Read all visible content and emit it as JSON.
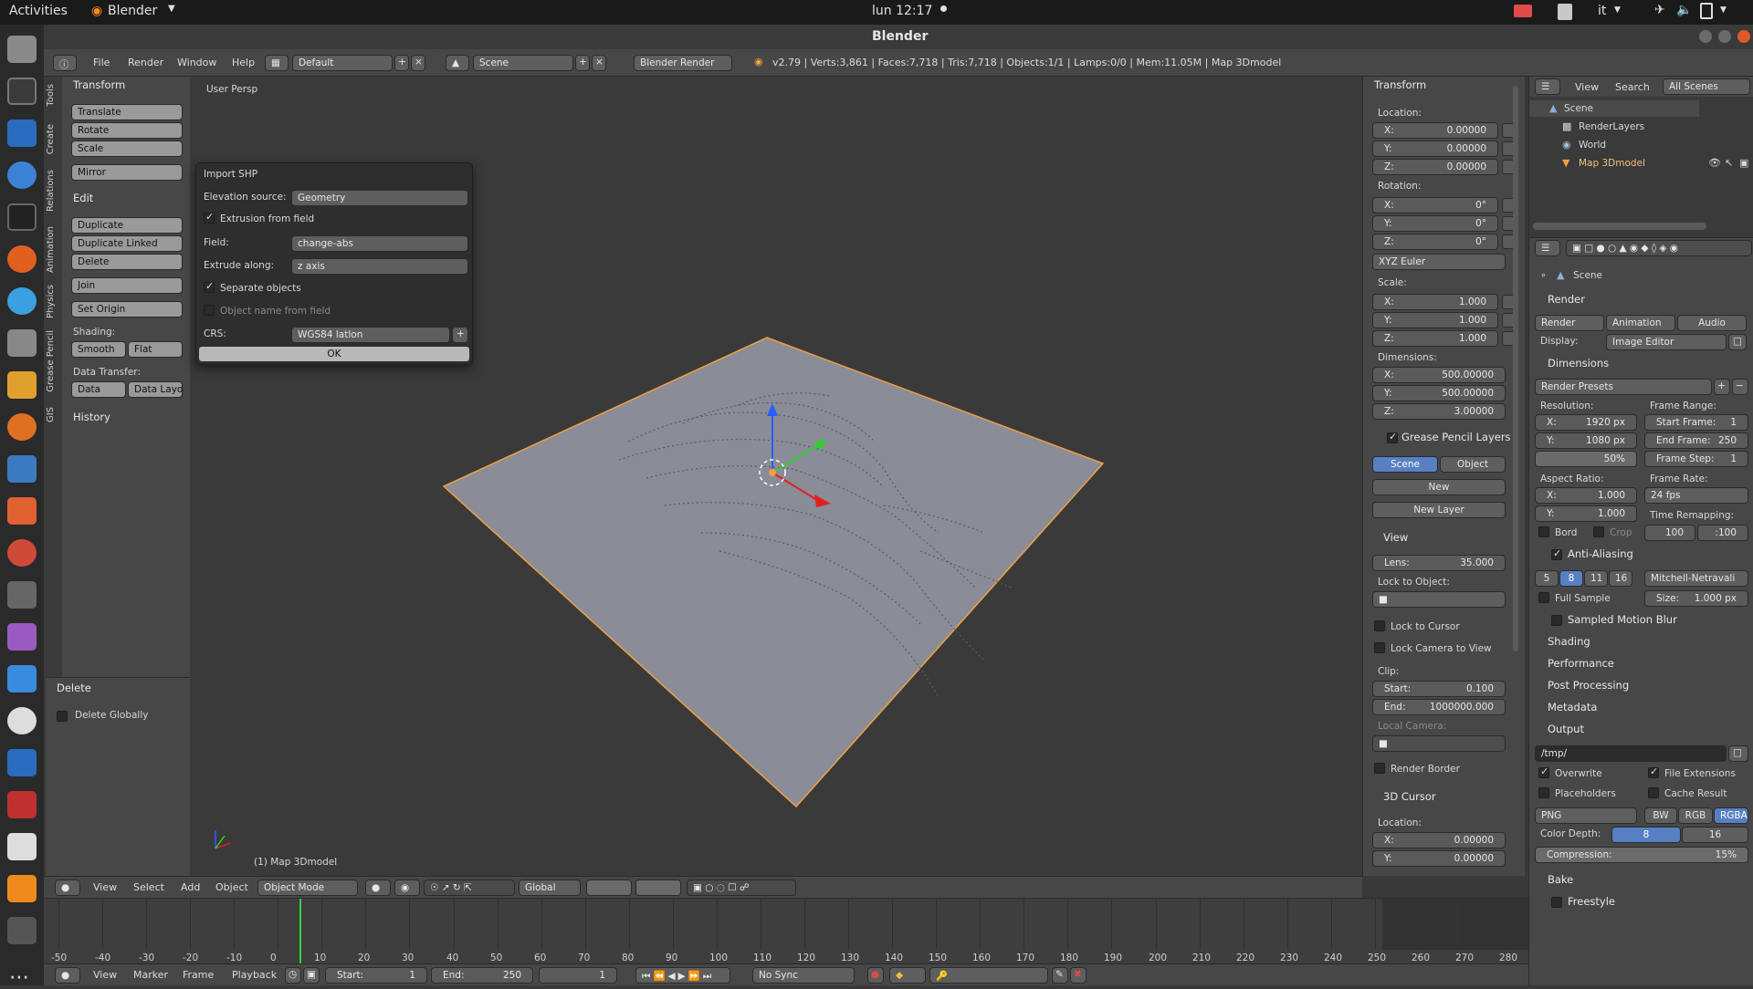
{
  "topbar": {
    "activities": "Activities",
    "app_menu": "Blender",
    "clock": "lun 12:17",
    "lang": "it"
  },
  "window": {
    "title": "Blender"
  },
  "infobar": {
    "menus": [
      "File",
      "Render",
      "Window",
      "Help"
    ],
    "layout": "Default",
    "scene": "Scene",
    "engine": "Blender Render",
    "stats": "v2.79 | Verts:3,861 | Faces:7,718 | Tris:7,718 | Objects:1/1 | Lamps:0/0 | Mem:11.05M | Map 3Dmodel"
  },
  "toolshelf": {
    "vtabs": [
      "Tools",
      "Create",
      "Relations",
      "Animation",
      "Physics",
      "Grease Pencil",
      "GIS"
    ],
    "transform_header": "Transform",
    "translate": "Translate",
    "rotate": "Rotate",
    "scale": "Scale",
    "mirror": "Mirror",
    "edit_header": "Edit",
    "duplicate": "Duplicate",
    "duplicate_linked": "Duplicate Linked",
    "delete": "Delete",
    "join": "Join",
    "set_origin": "Set Origin",
    "shading_label": "Shading:",
    "smooth": "Smooth",
    "flat": "Flat",
    "data_transfer_label": "Data Transfer:",
    "data": "Data",
    "data_layo": "Data Layo",
    "history_header": "History",
    "delete_header": "Delete",
    "delete_globally": "Delete Globally"
  },
  "dialog": {
    "title": "Import SHP",
    "elevation_label": "Elevation source:",
    "elevation_value": "Geometry",
    "extrusion_label": "Extrusion from field",
    "field_label": "Field:",
    "field_value": "change-abs",
    "extrude_label": "Extrude along:",
    "extrude_value": "z axis",
    "separate_label": "Separate objects",
    "objname_label": "Object name from field",
    "crs_label": "CRS:",
    "crs_value": "WGS84 latlon",
    "ok": "OK"
  },
  "viewport": {
    "persp": "User Persp",
    "object_label": "(1) Map 3Dmodel"
  },
  "viewheader": {
    "menus": [
      "View",
      "Select",
      "Add",
      "Object"
    ],
    "mode": "Object Mode",
    "orientation": "Global"
  },
  "npanel": {
    "transform_header": "Transform",
    "location_label": "Location:",
    "loc": [
      {
        "a": "X:",
        "v": "0.00000"
      },
      {
        "a": "Y:",
        "v": "0.00000"
      },
      {
        "a": "Z:",
        "v": "0.00000"
      }
    ],
    "rotation_label": "Rotation:",
    "rot": [
      {
        "a": "X:",
        "v": "0°"
      },
      {
        "a": "Y:",
        "v": "0°"
      },
      {
        "a": "Z:",
        "v": "0°"
      }
    ],
    "rotation_mode": "XYZ Euler",
    "scale_label": "Scale:",
    "scale": [
      {
        "a": "X:",
        "v": "1.000"
      },
      {
        "a": "Y:",
        "v": "1.000"
      },
      {
        "a": "Z:",
        "v": "1.000"
      }
    ],
    "dimensions_label": "Dimensions:",
    "dim": [
      {
        "a": "X:",
        "v": "500.00000"
      },
      {
        "a": "Y:",
        "v": "500.00000"
      },
      {
        "a": "Z:",
        "v": "3.00000"
      }
    ],
    "gp_header": "Grease Pencil Layers",
    "gp_scene": "Scene",
    "gp_object": "Object",
    "gp_new": "New",
    "gp_new_layer": "New Layer",
    "view_header": "View",
    "lens_label": "Lens:",
    "lens_value": "35.000",
    "lock_object_label": "Lock to Object:",
    "lock_cursor": "Lock to Cursor",
    "lock_camera": "Lock Camera to View",
    "clip_label": "Clip:",
    "clip_start_label": "Start:",
    "clip_start": "0.100",
    "clip_end_label": "End:",
    "clip_end": "1000000.000",
    "local_camera_label": "Local Camera:",
    "render_border": "Render Border",
    "cursor_header": "3D Cursor",
    "cursor_location_label": "Location:",
    "cursor": [
      {
        "a": "X:",
        "v": "0.00000"
      },
      {
        "a": "Y:",
        "v": "0.00000"
      }
    ]
  },
  "outliner": {
    "menus": [
      "View",
      "Search"
    ],
    "filter": "All Scenes",
    "items": [
      "Scene",
      "RenderLayers",
      "World",
      "Map 3Dmodel"
    ]
  },
  "props": {
    "context": "Scene",
    "render_header": "Render",
    "render_btn": "Render",
    "animation_btn": "Animation",
    "audio_btn": "Audio",
    "display_label": "Display:",
    "display_value": "Image Editor",
    "dimensions_header": "Dimensions",
    "render_presets": "Render Presets",
    "resolution_label": "Resolution:",
    "res_x": "1920 px",
    "res_y": "1080 px",
    "res_pct": "50%",
    "frame_range_label": "Frame Range:",
    "start_frame": "Start Frame:",
    "start_frame_v": "1",
    "end_frame": "End Frame:",
    "end_frame_v": "250",
    "frame_step": "Frame Step:",
    "frame_step_v": "1",
    "aspect_label": "Aspect Ratio:",
    "aspect_x": "1.000",
    "aspect_y": "1.000",
    "frame_rate_label": "Frame Rate:",
    "frame_rate": "24 fps",
    "bord": "Bord",
    "crop": "Crop",
    "time_remap_label": "Time Remapping:",
    "remap_old": "100",
    "remap_new": ":100",
    "aa_header": "Anti-Aliasing",
    "aa_samples": [
      "5",
      "8",
      "11",
      "16"
    ],
    "aa_filter": "Mitchell-Netravali",
    "full_sample": "Full Sample",
    "aa_size_label": "Size:",
    "aa_size": "1.000 px",
    "collapsed": [
      "Sampled Motion Blur",
      "Shading",
      "Performance",
      "Post Processing",
      "Metadata"
    ],
    "output_header": "Output",
    "output_path": "/tmp/",
    "overwrite": "Overwrite",
    "file_ext": "File Extensions",
    "placeholders": "Placeholders",
    "cache_result": "Cache Result",
    "format": "PNG",
    "bw": "BW",
    "rgb": "RGB",
    "rgba": "RGBA",
    "color_depth_label": "Color Depth:",
    "cd_8": "8",
    "cd_16": "16",
    "compression_label": "Compression:",
    "compression": "15%",
    "bake": "Bake",
    "freestyle": "Freestyle"
  },
  "timeline": {
    "ticks": [
      "-50",
      "-40",
      "-30",
      "-20",
      "-10",
      "0",
      "10",
      "20",
      "30",
      "40",
      "50",
      "60",
      "70",
      "80",
      "90",
      "100",
      "110",
      "120",
      "130",
      "140",
      "150",
      "160",
      "170",
      "180",
      "190",
      "200",
      "210",
      "220",
      "230",
      "240",
      "250",
      "260",
      "270",
      "280"
    ],
    "menus": [
      "View",
      "Marker",
      "Frame",
      "Playback"
    ],
    "start_label": "Start:",
    "start": "1",
    "end_label": "End:",
    "end": "250",
    "current": "1",
    "sync": "No Sync"
  },
  "colors": {
    "accent": "#5680c2",
    "selection": "#f0a040",
    "mesh": "#8a8c98"
  }
}
